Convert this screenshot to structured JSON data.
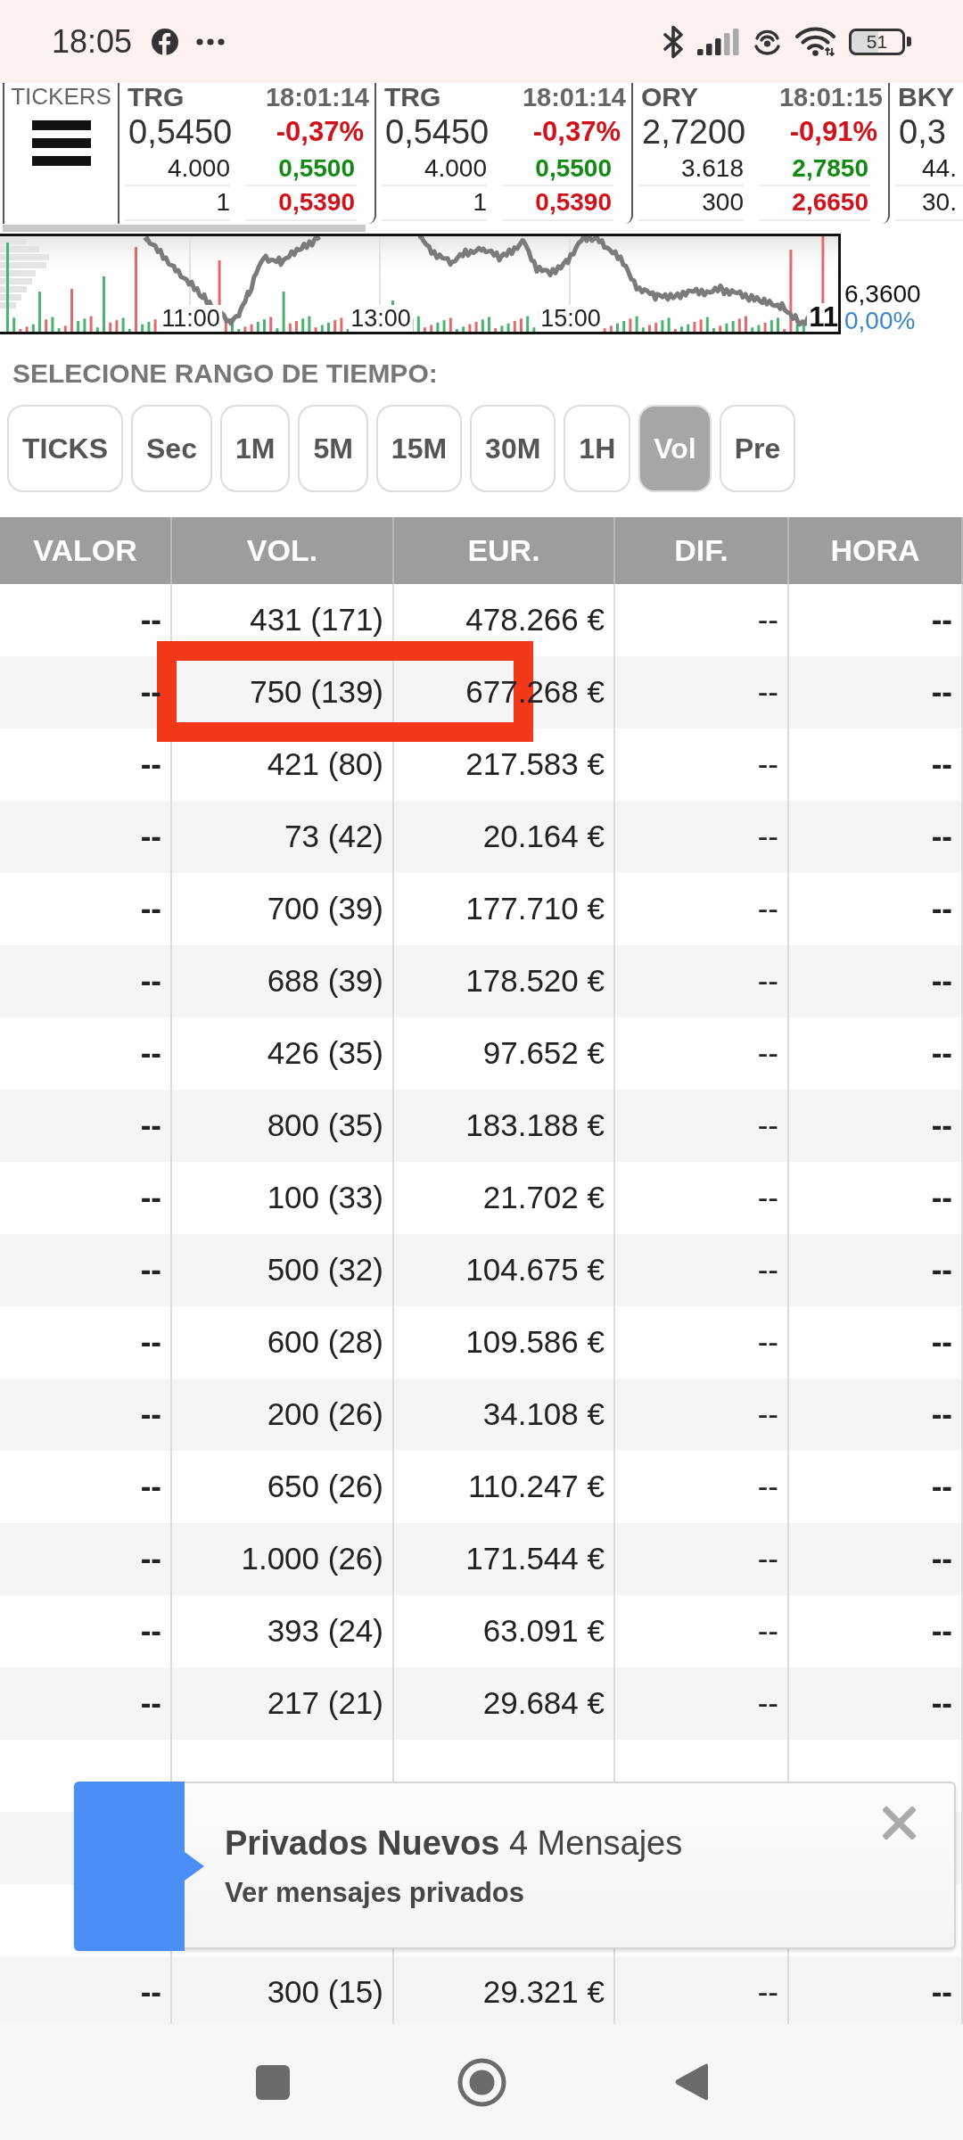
{
  "status_bar": {
    "time": "18:05",
    "battery": "51"
  },
  "tickers": {
    "label": "TICKERS",
    "items": [
      {
        "kind": "full",
        "symbol": "TRG",
        "time": "18:01:14",
        "price": "0,5450",
        "change": "-0,37%",
        "volume_1": "4.000",
        "price_1": "0,5500",
        "volume_2": "1",
        "price_2": "0,5390"
      },
      {
        "kind": "full",
        "symbol": "TRG",
        "time": "18:01:14",
        "price": "0,5450",
        "change": "-0,37%",
        "volume_1": "4.000",
        "price_1": "0,5500",
        "volume_2": "1",
        "price_2": "0,5390"
      },
      {
        "kind": "full",
        "symbol": "ORY",
        "time": "18:01:15",
        "price": "2,7200",
        "change": "-0,91%",
        "volume_1": "3.618",
        "price_1": "2,7850",
        "volume_2": "300",
        "price_2": "2,6650"
      },
      {
        "kind": "edge",
        "symbol": "BKY",
        "price": "0,3",
        "volume_1": "44.",
        "volume_2": "30."
      }
    ]
  },
  "chart": {
    "time_labels": [
      "11:00",
      "13:00",
      "15:00"
    ],
    "edge_label": "11",
    "last_price": "6,3600",
    "change": "0,00%"
  },
  "time_range": {
    "label": "SELECIONE RANGO DE TIEMPO:",
    "options": [
      {
        "label": "TICKS",
        "selected": false
      },
      {
        "label": "Sec",
        "selected": false
      },
      {
        "label": "1M",
        "selected": false
      },
      {
        "label": "5M",
        "selected": false
      },
      {
        "label": "15M",
        "selected": false
      },
      {
        "label": "30M",
        "selected": false
      },
      {
        "label": "1H",
        "selected": false
      },
      {
        "label": "Vol",
        "selected": true
      },
      {
        "label": "Pre",
        "selected": false
      }
    ]
  },
  "table": {
    "columns": [
      "VALOR",
      "VOL.",
      "EUR.",
      "DIF.",
      "HORA"
    ],
    "rows": [
      {
        "valor": "--",
        "vol": "431 (171)",
        "eur": "478.266 €",
        "dif": "--",
        "hora": "--",
        "highlighted": false
      },
      {
        "valor": "--",
        "vol": "750 (139)",
        "eur": "677.268 €",
        "dif": "--",
        "hora": "--",
        "highlighted": true
      },
      {
        "valor": "--",
        "vol": "421 (80)",
        "eur": "217.583 €",
        "dif": "--",
        "hora": "--",
        "highlighted": false
      },
      {
        "valor": "--",
        "vol": "73 (42)",
        "eur": "20.164 €",
        "dif": "--",
        "hora": "--",
        "highlighted": false
      },
      {
        "valor": "--",
        "vol": "700 (39)",
        "eur": "177.710 €",
        "dif": "--",
        "hora": "--",
        "highlighted": false
      },
      {
        "valor": "--",
        "vol": "688 (39)",
        "eur": "178.520 €",
        "dif": "--",
        "hora": "--",
        "highlighted": false
      },
      {
        "valor": "--",
        "vol": "426 (35)",
        "eur": "97.652 €",
        "dif": "--",
        "hora": "--",
        "highlighted": false
      },
      {
        "valor": "--",
        "vol": "800 (35)",
        "eur": "183.188 €",
        "dif": "--",
        "hora": "--",
        "highlighted": false
      },
      {
        "valor": "--",
        "vol": "100 (33)",
        "eur": "21.702 €",
        "dif": "--",
        "hora": "--",
        "highlighted": false
      },
      {
        "valor": "--",
        "vol": "500 (32)",
        "eur": "104.675 €",
        "dif": "--",
        "hora": "--",
        "highlighted": false
      },
      {
        "valor": "--",
        "vol": "600 (28)",
        "eur": "109.586 €",
        "dif": "--",
        "hora": "--",
        "highlighted": false
      },
      {
        "valor": "--",
        "vol": "200 (26)",
        "eur": "34.108 €",
        "dif": "--",
        "hora": "--",
        "highlighted": false
      },
      {
        "valor": "--",
        "vol": "650 (26)",
        "eur": "110.247 €",
        "dif": "--",
        "hora": "--",
        "highlighted": false
      },
      {
        "valor": "--",
        "vol": "1.000 (26)",
        "eur": "171.544 €",
        "dif": "--",
        "hora": "--",
        "highlighted": false
      },
      {
        "valor": "--",
        "vol": "393 (24)",
        "eur": "63.091 €",
        "dif": "--",
        "hora": "--",
        "highlighted": false
      },
      {
        "valor": "--",
        "vol": "217 (21)",
        "eur": "29.684 €",
        "dif": "--",
        "hora": "--",
        "highlighted": false
      }
    ],
    "rows_below_notification": [
      {
        "valor": "--",
        "vol": "300 (15)",
        "eur": "29.321 €",
        "dif": "--",
        "hora": "--",
        "highlighted": false
      }
    ]
  },
  "notification": {
    "title": "**Privados Nuevos** 4 Mensajes",
    "link": "Ver mensajes privados"
  }
}
